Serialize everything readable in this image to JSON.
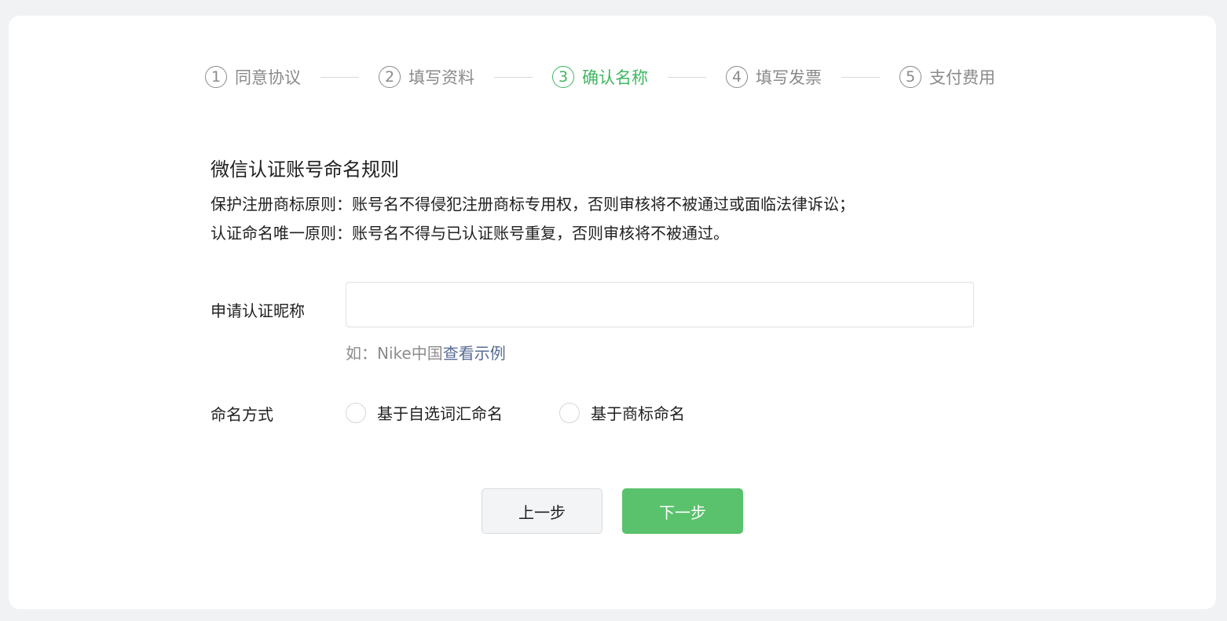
{
  "steps": [
    {
      "num": "1",
      "label": "同意协议",
      "active": false
    },
    {
      "num": "2",
      "label": "填写资料",
      "active": false
    },
    {
      "num": "3",
      "label": "确认名称",
      "active": true
    },
    {
      "num": "4",
      "label": "填写发票",
      "active": false
    },
    {
      "num": "5",
      "label": "支付费用",
      "active": false
    }
  ],
  "rules": {
    "title": "微信认证账号命名规则",
    "line1": "保护注册商标原则：账号名不得侵犯注册商标专用权，否则审核将不被通过或面临法律诉讼；",
    "line2": "认证命名唯一原则：账号名不得与已认证账号重复，否则审核将不被通过。"
  },
  "form": {
    "nickname_label": "申请认证昵称",
    "nickname_value": "",
    "hint_prefix": "如：Nike中国",
    "hint_link": "查看示例",
    "method_label": "命名方式",
    "method_options": [
      "基于自选词汇命名",
      "基于商标命名"
    ]
  },
  "buttons": {
    "prev": "上一步",
    "next": "下一步"
  },
  "colors": {
    "accent": "#3fb760",
    "primary_button": "#5ac26c",
    "link": "#576b95",
    "inactive_step": "#8a8a8a"
  }
}
